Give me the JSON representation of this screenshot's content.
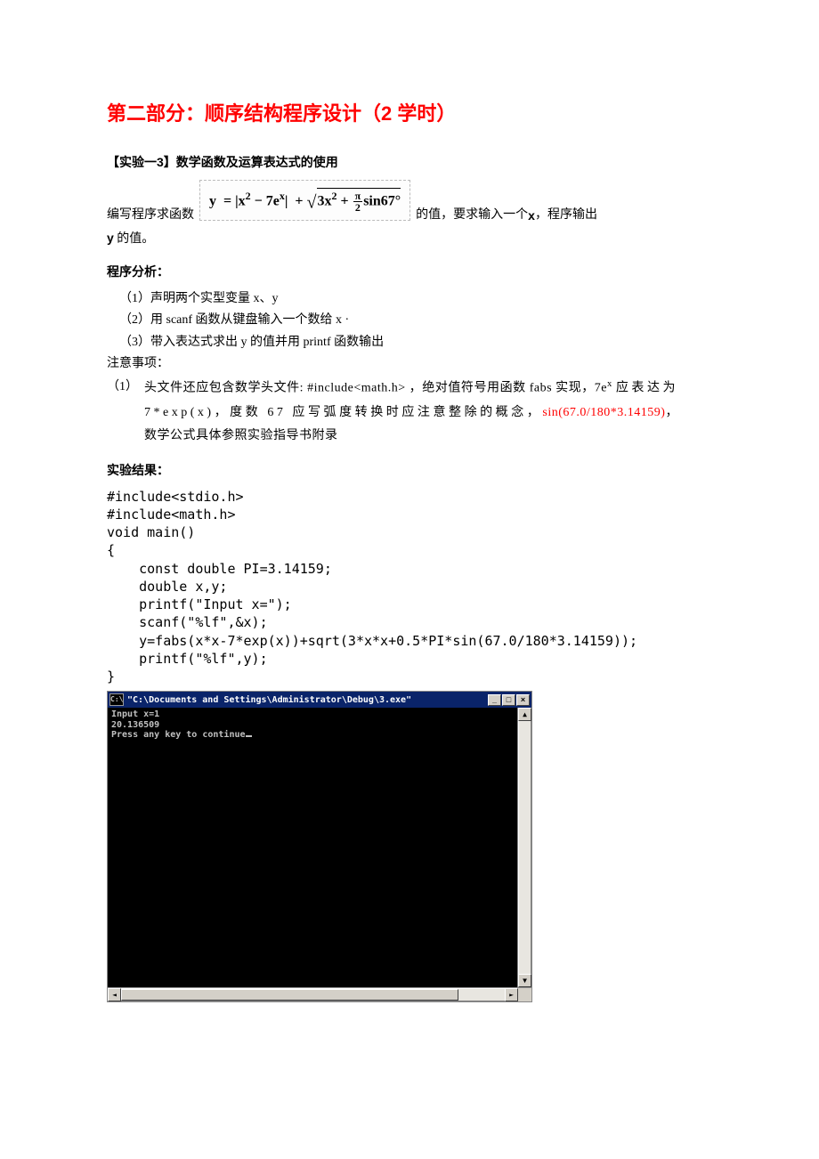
{
  "title": "第二部分：顺序结构程序设计（2 学时）",
  "exp_heading": "【实验一3】数学函数及运算表达式的使用",
  "line1_pre": "编写程序求函数",
  "formula": {
    "lhs": "y",
    "abs_inner_a": "x",
    "abs_inner_b": " − 7e",
    "abs_inner_exp": "x",
    "sqrt_a": "3x",
    "sqrt_b": " + ",
    "frac_num": "π",
    "frac_den": "2",
    "sqrt_c": "sin67°"
  },
  "line1_mid": "的值，要求输入一个 ",
  "line1_x": "x",
  "line1_post": "，程序输出",
  "line2_y": "y",
  "line2_post": " 的值。",
  "analysis_heading": "程序分析：",
  "step1": "（1）声明两个实型变量  x、y",
  "step2": "（2）用  scanf  函数从键盘输入一个数给  x ·",
  "step3": "（3）带入表达式求出  y  的值并用  printf  函数输出",
  "notes_heading": "注意事项：",
  "note_label": "（1）",
  "note_text1": "头文件还应包含数学头文件: #include<math.h>  ，绝对值符号用函数 fabs 实现，7e",
  "note_sup": "x",
  "note_text2_wide": "应表达为 7*exp(x)，度数 67 应写弧度转换时应注意整除的概念，",
  "note_text3_red": "sin(67.0/180*3.14159)",
  "note_text3_tail": "，数学公式具体参照实验指导书附录",
  "result_heading": "实验结果：",
  "code": "#include<stdio.h>\n#include<math.h>\nvoid main()\n{\n    const double PI=3.14159;\n    double x,y;\n    printf(\"Input x=\");\n    scanf(\"%lf\",&x);\n    y=fabs(x*x-7*exp(x))+sqrt(3*x*x+0.5*PI*sin(67.0/180*3.14159));\n    printf(\"%lf\",y);\n}",
  "console": {
    "cmd_icon": "C:\\",
    "title": "\"C:\\Documents and Settings\\Administrator\\Debug\\3.exe\"",
    "min": "_",
    "max": "□",
    "close": "×",
    "output": "Input x=1\n20.136509\nPress any key to continue",
    "up": "▲",
    "down": "▼",
    "left": "◄",
    "right": "►"
  }
}
